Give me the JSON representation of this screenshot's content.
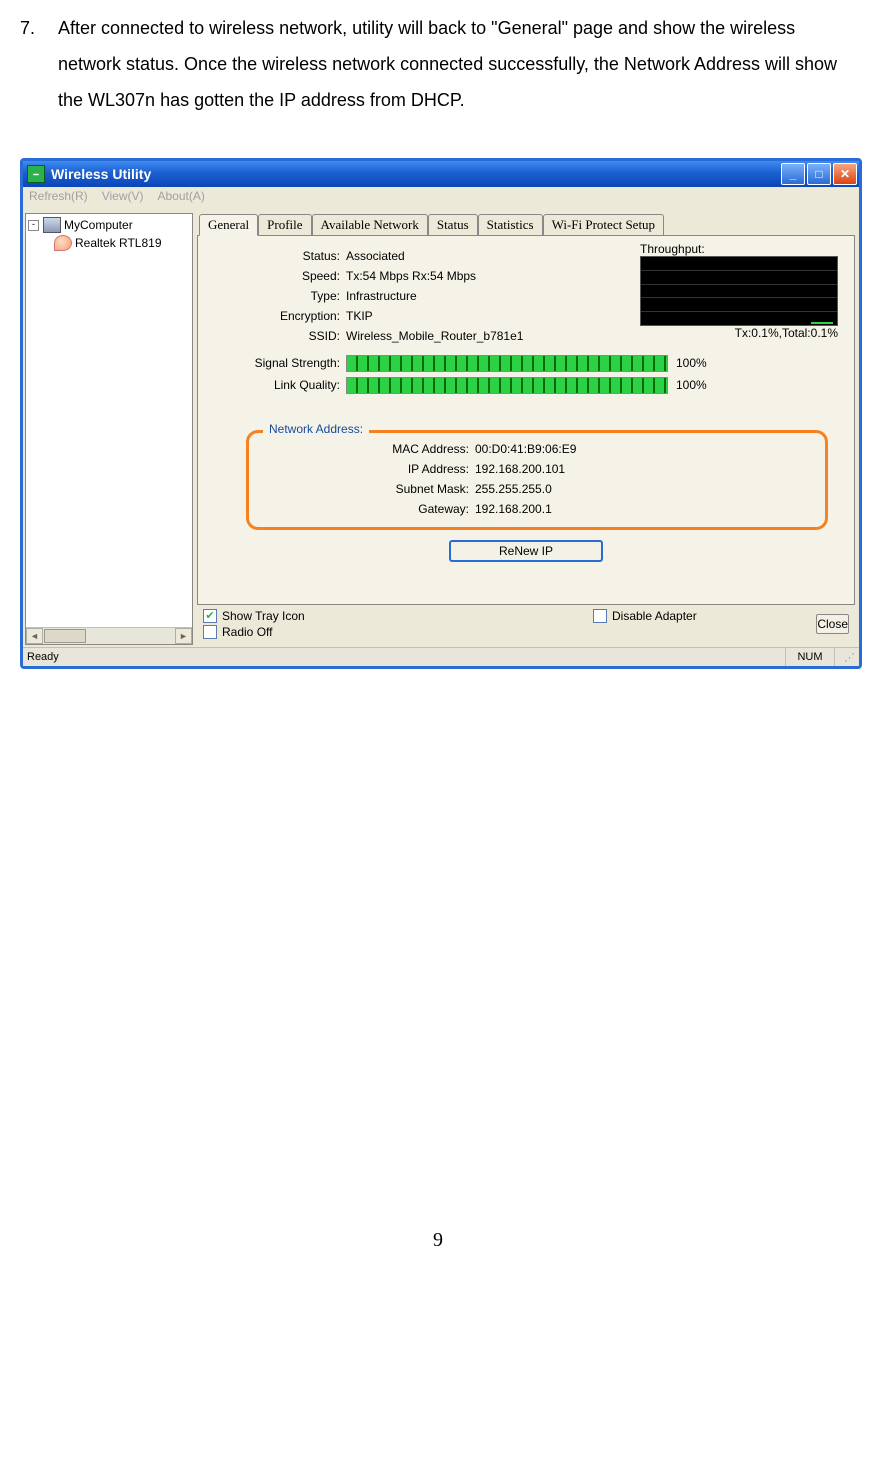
{
  "instruction": {
    "number": "7.",
    "text": "After connected to wireless network, utility will back to \"General\" page and show the wireless network status. Once the wireless network connected successfully, the Network Address will show the WL307n has gotten the IP address from DHCP."
  },
  "window": {
    "title": "Wireless Utility",
    "menu": {
      "refresh": "Refresh(R)",
      "view": "View(V)",
      "about": "About(A)"
    },
    "tree": {
      "root": "MyComputer",
      "adapter": "Realtek RTL819"
    },
    "tabs": {
      "general": "General",
      "profile": "Profile",
      "available": "Available Network",
      "status": "Status",
      "stats": "Statistics",
      "wps": "Wi-Fi Protect Setup"
    },
    "fields": {
      "status_label": "Status:",
      "status_value": "Associated",
      "speed_label": "Speed:",
      "speed_value": "Tx:54 Mbps Rx:54 Mbps",
      "type_label": "Type:",
      "type_value": "Infrastructure",
      "encryption_label": "Encryption:",
      "encryption_value": "TKIP",
      "ssid_label": "SSID:",
      "ssid_value": "Wireless_Mobile_Router_b781e1",
      "signal_label": "Signal Strength:",
      "signal_value": "100%",
      "link_label": "Link Quality:",
      "link_value": "100%"
    },
    "throughput": {
      "label": "Throughput:",
      "text": "Tx:0.1%,Total:0.1%"
    },
    "network_address": {
      "legend": "Network Address:",
      "mac_label": "MAC Address:",
      "mac_value": "00:D0:41:B9:06:E9",
      "ip_label": "IP Address:",
      "ip_value": "192.168.200.101",
      "subnet_label": "Subnet Mask:",
      "subnet_value": "255.255.255.0",
      "gateway_label": "Gateway:",
      "gateway_value": "192.168.200.1"
    },
    "buttons": {
      "renew_ip": "ReNew IP",
      "close": "Close"
    },
    "checks": {
      "show_tray": "Show Tray Icon",
      "radio_off": "Radio Off",
      "disable_adapter": "Disable Adapter"
    },
    "statusbar": {
      "ready": "Ready",
      "num": "NUM"
    }
  },
  "page_number": "9"
}
